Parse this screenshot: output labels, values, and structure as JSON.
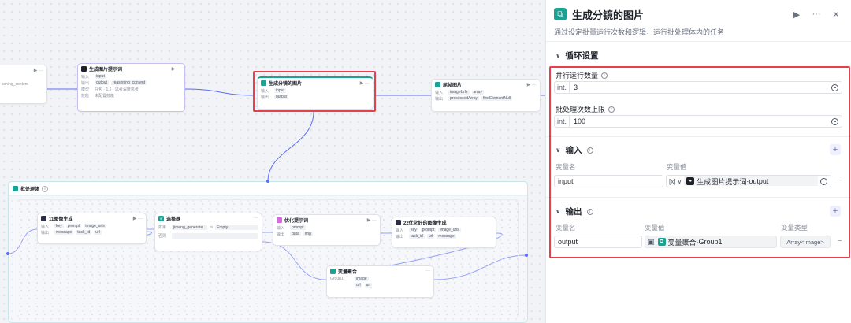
{
  "canvas": {
    "node0": {
      "row1": "soning_content"
    },
    "node_prompt": {
      "title": "生成图片提示词",
      "in_label": "输入",
      "in_chip": "input",
      "out_label": "输出",
      "out_chips": [
        "output",
        "reasoning_content"
      ],
      "model_label": "模型",
      "model_value": "豆包 · 1.6 · 思考深度思考",
      "skill_label": "技能",
      "skill_value": "未配置技能"
    },
    "node_split": {
      "title": "生成分镜的图片",
      "in_label": "输入",
      "in_chip": "input",
      "out_label": "输出",
      "out_chip": "output"
    },
    "node_tail": {
      "title": "尾帧图片",
      "in_label": "输入",
      "in_chips": [
        "imageUrls",
        "array"
      ],
      "out_label": "输出",
      "out_chips": [
        "processedArray",
        "firstElementNull"
      ]
    },
    "batch": {
      "title": "批处理体",
      "node_img11": {
        "title": "11图像生成",
        "in_label": "输入",
        "in_chips": [
          "key",
          "prompt",
          "image_urls"
        ],
        "out_label": "输出",
        "out_chips": [
          "message",
          "task_id",
          "url"
        ]
      },
      "node_selector": {
        "title": "选择器",
        "if_badge": "IF",
        "cond_label": "如果",
        "cond_var": "jimeng_generate...",
        "cond_op": "is",
        "cond_val": "Empty",
        "else_label": "否则"
      },
      "node_opt": {
        "title": "优化提示词",
        "in_label": "输入",
        "in_chip": "prompt",
        "out_label": "输出",
        "out_chips": [
          "data",
          "img"
        ]
      },
      "node_img22": {
        "title": "22优化好的图像生成",
        "in_label": "输入",
        "in_chips": [
          "key",
          "prompt",
          "image_urls"
        ],
        "out_label": "输出",
        "out_chips": [
          "task_id",
          "url",
          "message"
        ]
      },
      "node_agg": {
        "title": "变量聚合",
        "group_label": "Group1",
        "chips": [
          "image",
          "url",
          "url"
        ]
      }
    }
  },
  "panel": {
    "title": "生成分镜的图片",
    "description": "通过设定批量运行次数和逻辑，运行批处理体内的任务",
    "run_icon": "▶",
    "more_icon": "···",
    "close_icon": "✕",
    "loop_section": {
      "title": "循环设置",
      "parallel_label": "并行运行数量",
      "parallel_type": "int.",
      "parallel_value": "3",
      "max_label": "批处理次数上限",
      "max_type": "int.",
      "max_value": "100"
    },
    "input_section": {
      "title": "输入",
      "col_name": "变量名",
      "col_value": "变量值",
      "row": {
        "name": "input",
        "type_icon": "[x]",
        "ref_node": "生成图片提示词",
        "ref_var": "output",
        "ref_sep": " · "
      }
    },
    "output_section": {
      "title": "输出",
      "col_name": "变量名",
      "col_value": "变量值",
      "col_type": "变量类型",
      "row": {
        "name": "output",
        "ref_node": "变量聚合",
        "ref_var": "Group1",
        "ref_sep": " · ",
        "type": "Array<Image>"
      }
    }
  },
  "colors": {
    "accent": "#5b6ef5",
    "highlight": "#e5404c",
    "teal": "#1aa293"
  }
}
